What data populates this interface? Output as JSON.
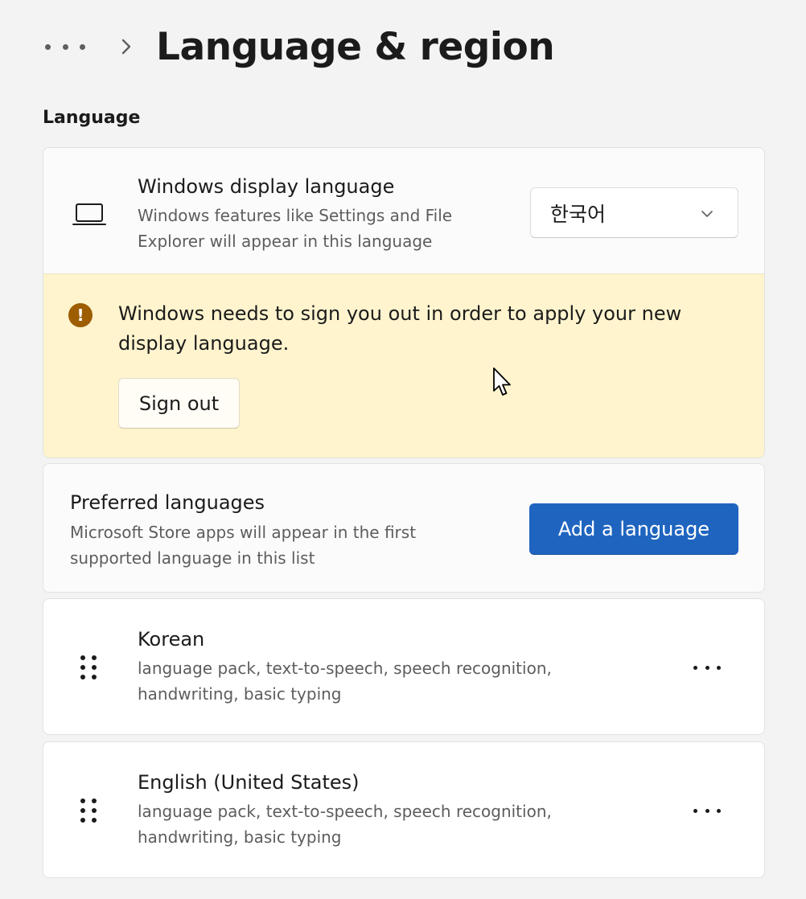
{
  "header": {
    "title": "Language & region",
    "more_icon": "more-horizontal-icon",
    "separator_icon": "chevron-right-icon"
  },
  "section": {
    "label": "Language"
  },
  "display_language": {
    "icon": "laptop-icon",
    "title": "Windows display language",
    "description": "Windows features like Settings and File Explorer will appear in this language",
    "selected": "한국어",
    "dropdown_icon": "chevron-down-icon"
  },
  "warning": {
    "icon": "warning-icon",
    "message": "Windows needs to sign you out in order to apply your new display language.",
    "button_label": "Sign out"
  },
  "preferred": {
    "title": "Preferred languages",
    "description": "Microsoft Store apps will appear in the first supported language in this list",
    "button_label": "Add a language"
  },
  "languages": [
    {
      "name": "Korean",
      "features": "language pack, text-to-speech, speech recognition, handwriting, basic typing"
    },
    {
      "name": "English (United States)",
      "features": "language pack, text-to-speech, speech recognition, handwriting, basic typing"
    }
  ],
  "colors": {
    "background": "#f3f3f3",
    "card": "#fbfbfb",
    "warning_bg": "#fff4ce",
    "warning_icon": "#9d5d00",
    "accent": "#1f65c0"
  }
}
